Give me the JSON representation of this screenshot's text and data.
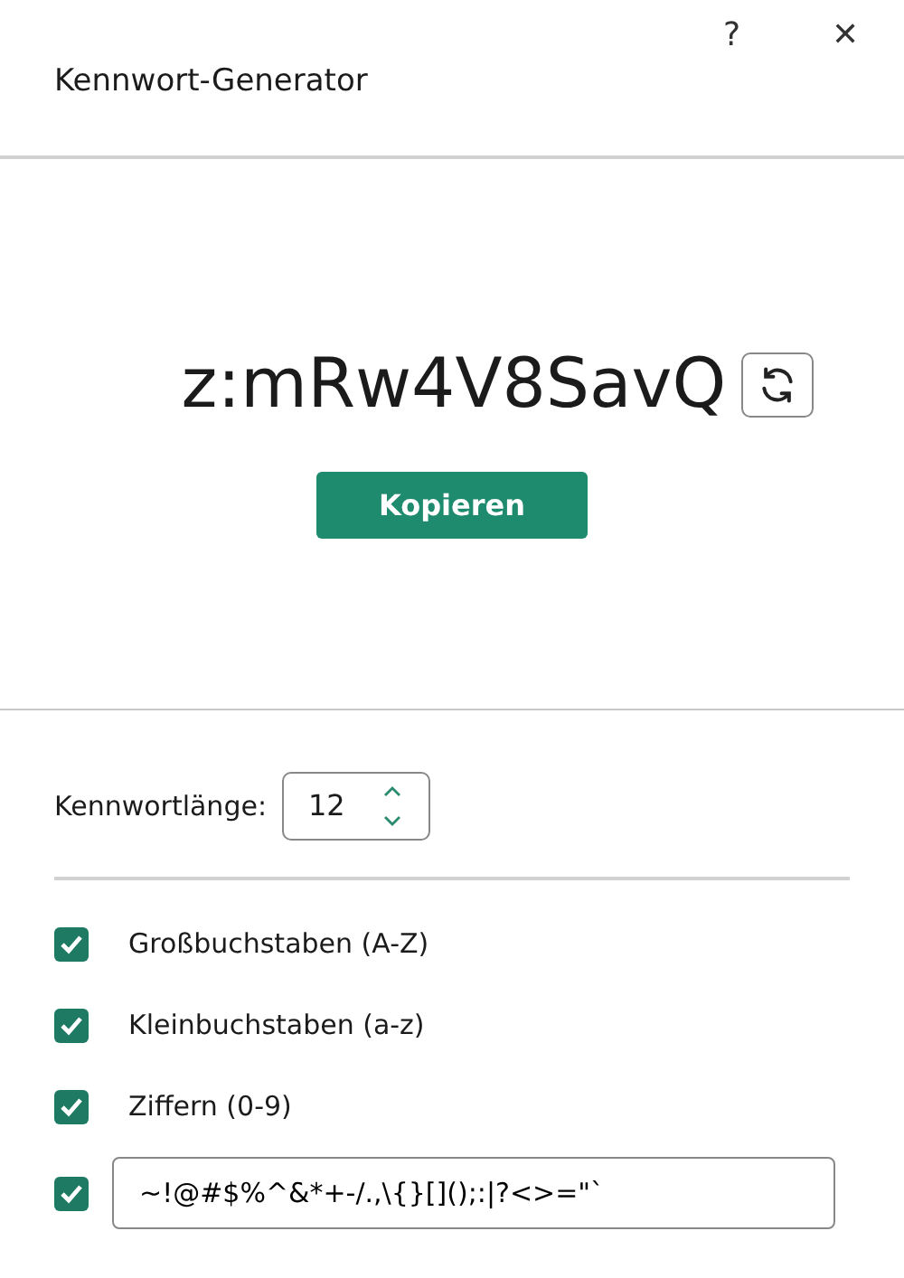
{
  "window": {
    "title": "Kennwort-Generator",
    "help": "?",
    "close": "✕"
  },
  "password": {
    "value": "z:mRw4V8SavQ"
  },
  "copy_button": "Kopieren",
  "length": {
    "label": "Kennwortlänge:",
    "value": "12"
  },
  "options": [
    {
      "kind": "checkbox",
      "label": "Großbuchstaben (A-Z)",
      "checked": true
    },
    {
      "kind": "checkbox",
      "label": "Kleinbuchstaben (a-z)",
      "checked": true
    },
    {
      "kind": "checkbox",
      "label": "Ziffern (0-9)",
      "checked": true
    },
    {
      "kind": "field",
      "value": "~!@#$%^&*+-/.,\\{}[]();:|?<>=\"`",
      "checked": true
    }
  ]
}
